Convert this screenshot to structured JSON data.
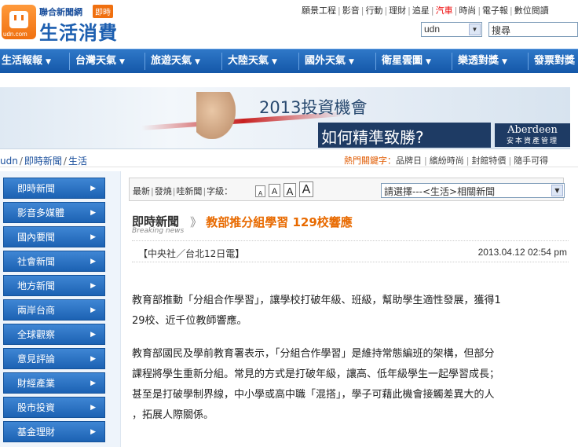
{
  "header": {
    "brand_top": "聯合新聞網",
    "brand_tag": "即時",
    "brand_main": "生活消費",
    "logo_text": "udn.com",
    "top_links": [
      {
        "label": "願景工程",
        "hot": false
      },
      {
        "label": "影音",
        "hot": false
      },
      {
        "label": "行動",
        "hot": false
      },
      {
        "label": "理財",
        "hot": false
      },
      {
        "label": "追星",
        "hot": false
      },
      {
        "label": "汽車",
        "hot": true
      },
      {
        "label": "時尚",
        "hot": false
      },
      {
        "label": "電子報",
        "hot": false
      },
      {
        "label": "數位閱讀",
        "hot": false
      }
    ],
    "site_select_value": "udn",
    "search_value": "搜尋"
  },
  "nav": {
    "items": [
      "生活報報",
      "台灣天氣",
      "旅遊天氣",
      "大陸天氣",
      "國外天氣",
      "衛星雲圖",
      "樂透對獎",
      "發票對獎"
    ]
  },
  "banner": {
    "title": "2013投資機會",
    "subtitle": "如何精準致勝?",
    "logo_en": "Aberdeen",
    "logo_zh": "安本資產管理"
  },
  "breadcrumb": {
    "items": [
      "udn",
      "即時新聞",
      "生活"
    ],
    "separator": "/"
  },
  "hotwords": {
    "label": "熱門關鍵字：",
    "items": [
      "品牌日",
      "繽紛時尚",
      "封館特價",
      "隨手可得"
    ]
  },
  "sidebar": {
    "items": [
      "即時新聞",
      "影音多媒體",
      "國內要聞",
      "社會新聞",
      "地方新聞",
      "兩岸台商",
      "全球觀察",
      "意見評論",
      "財經產業",
      "股市投資",
      "基金理財"
    ]
  },
  "toolbar": {
    "links": [
      "最新",
      "發燒",
      "哇新聞"
    ],
    "font_size_label": "字級：",
    "font_sizes": [
      "A",
      "A",
      "A",
      "A"
    ],
    "related_select": "請選擇---<生活>相關新聞"
  },
  "article": {
    "section": "即時新聞",
    "section_sub": "Breaking news",
    "mark": "》",
    "title": "教部推分組學習 129校響應",
    "source": "【中央社／台北12日電】",
    "datetime": "2013.04.12 02:54 pm",
    "paragraphs": [
      [
        "教育部推動「分組合作學習」，讓學校打破年級、班級，幫助學生適性發展，獲得1",
        "29校、近千位教師響應。"
      ],
      [
        "教育部國民及學前教育署表示，「分組合作學習」是維持常態編班的架構，但部分",
        "課程將學生重新分組。常見的方式是打破年級，讓高、低年級學生一起學習成長；",
        "甚至是打破學制界線，中小學或高中職「混搭」，學子可藉此機會接觸差異大的人",
        "，拓展人際關係。"
      ]
    ]
  },
  "colors": {
    "nav_blue": "#1d5fb0",
    "headline_orange": "#e86a00",
    "hot_red": "#e00000"
  }
}
